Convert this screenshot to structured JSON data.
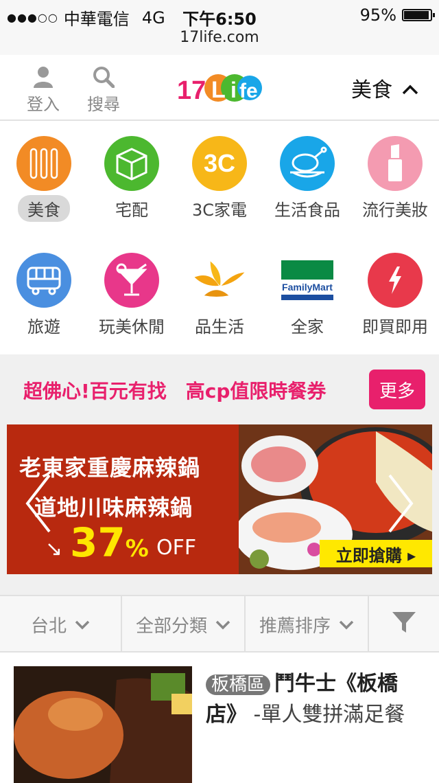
{
  "status_bar": {
    "carrier": "中華電信",
    "network": "4G",
    "time": "下午6:50",
    "battery": "95%",
    "battery_level": 0.95,
    "url": "17life.com"
  },
  "header": {
    "login_label": "登入",
    "search_label": "搜尋",
    "logo_text": "17Life",
    "category_selected": "美食",
    "icons": [
      "user-icon",
      "search-icon",
      "chevron-up-icon"
    ]
  },
  "categories": [
    {
      "label": "美食",
      "icon": "utensils-icon",
      "color": "#f28b25",
      "active": true
    },
    {
      "label": "宅配",
      "icon": "box-icon",
      "color": "#4cb82f"
    },
    {
      "label": "3C家電",
      "icon": "3c-icon",
      "color": "#f7b718"
    },
    {
      "label": "生活食品",
      "icon": "roast-chicken-icon",
      "color": "#19a6e8"
    },
    {
      "label": "流行美妝",
      "icon": "lipstick-icon",
      "color": "#f49bb1"
    },
    {
      "label": "旅遊",
      "icon": "bus-icon",
      "color": "#4a8fe0"
    },
    {
      "label": "玩美休閒",
      "icon": "cocktail-icon",
      "color": "#e8378a"
    },
    {
      "label": "品生活",
      "icon": "leaf-logo-icon",
      "color": "#f4a410"
    },
    {
      "label": "全家",
      "icon": "familymart-logo",
      "color": "#0a8a44"
    },
    {
      "label": "即買即用",
      "icon": "lightning-icon",
      "color": "#e8394b"
    }
  ],
  "familymart_logo_text": "FamilyMart",
  "category_3c_text": "3C",
  "promo": {
    "text": "超佛心!百元有找　高cp值限時餐券",
    "more_label": "更多",
    "accent": "#e8206c"
  },
  "banner": {
    "line1": "老東家重慶麻辣鍋",
    "line2": "道地川味麻辣鍋",
    "discount_number": "37",
    "discount_sign": "%",
    "off": "OFF",
    "buy_label": "立即搶購 ▸",
    "prev_icon": "chevron-left-icon",
    "next_icon": "chevron-right-icon"
  },
  "filters": [
    {
      "label": "台北",
      "icon": "chevron-down-icon"
    },
    {
      "label": "全部分類",
      "icon": "chevron-down-icon"
    },
    {
      "label": "推薦排序",
      "icon": "chevron-down-icon"
    },
    {
      "label": "",
      "icon": "filter-icon"
    }
  ],
  "deal": {
    "district": "板橋區",
    "title": "鬥牛士《板橋店》",
    "subtitle": "-單人雙拼滿足餐"
  }
}
